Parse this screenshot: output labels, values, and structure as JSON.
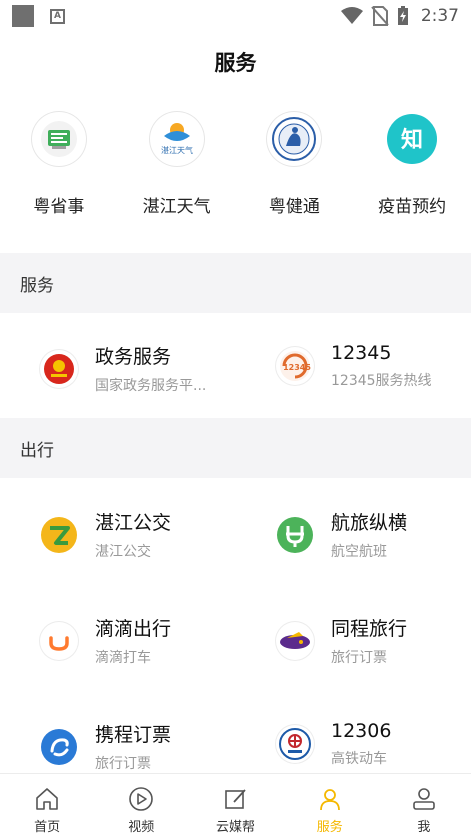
{
  "status_bar": {
    "time": "2:37"
  },
  "header": {
    "title": "服务"
  },
  "quick_links": [
    {
      "label": "粤省事",
      "icon": "yueshengshi-icon"
    },
    {
      "label": "湛江天气",
      "icon": "zhanjiang-weather-icon",
      "icon_text": "湛江天气"
    },
    {
      "label": "粤健通",
      "icon": "yuejiantong-icon"
    },
    {
      "label": "疫苗预约",
      "icon": "vaccine-icon",
      "icon_text": "知"
    }
  ],
  "sections": [
    {
      "title": "服务",
      "items": [
        {
          "title": "政务服务",
          "subtitle": "国家政务服务平...",
          "icon": "gov-service-icon"
        },
        {
          "title": "12345",
          "subtitle": "12345服务热线",
          "icon": "hotline-12345-icon",
          "icon_text": "12345"
        }
      ]
    },
    {
      "title": "出行",
      "items": [
        {
          "title": "湛江公交",
          "subtitle": "湛江公交",
          "icon": "zhanjiang-bus-icon"
        },
        {
          "title": "航旅纵横",
          "subtitle": "航空航班",
          "icon": "hanglv-icon"
        },
        {
          "title": "滴滴出行",
          "subtitle": "滴滴打车",
          "icon": "didi-icon"
        },
        {
          "title": "同程旅行",
          "subtitle": "旅行订票",
          "icon": "tongcheng-icon"
        },
        {
          "title": "携程订票",
          "subtitle": "旅行订票",
          "icon": "ctrip-icon"
        },
        {
          "title": "12306",
          "subtitle": "高铁动车",
          "icon": "railway-12306-icon"
        }
      ]
    }
  ],
  "bottom_nav": [
    {
      "label": "首页",
      "icon": "home-icon"
    },
    {
      "label": "视频",
      "icon": "video-play-icon"
    },
    {
      "label": "云媒帮",
      "icon": "edit-icon"
    },
    {
      "label": "服务",
      "icon": "person-icon",
      "active": true
    },
    {
      "label": "我",
      "icon": "profile-icon"
    }
  ],
  "colors": {
    "accent": "#f5b800",
    "section_bg": "#f4f4f6"
  }
}
